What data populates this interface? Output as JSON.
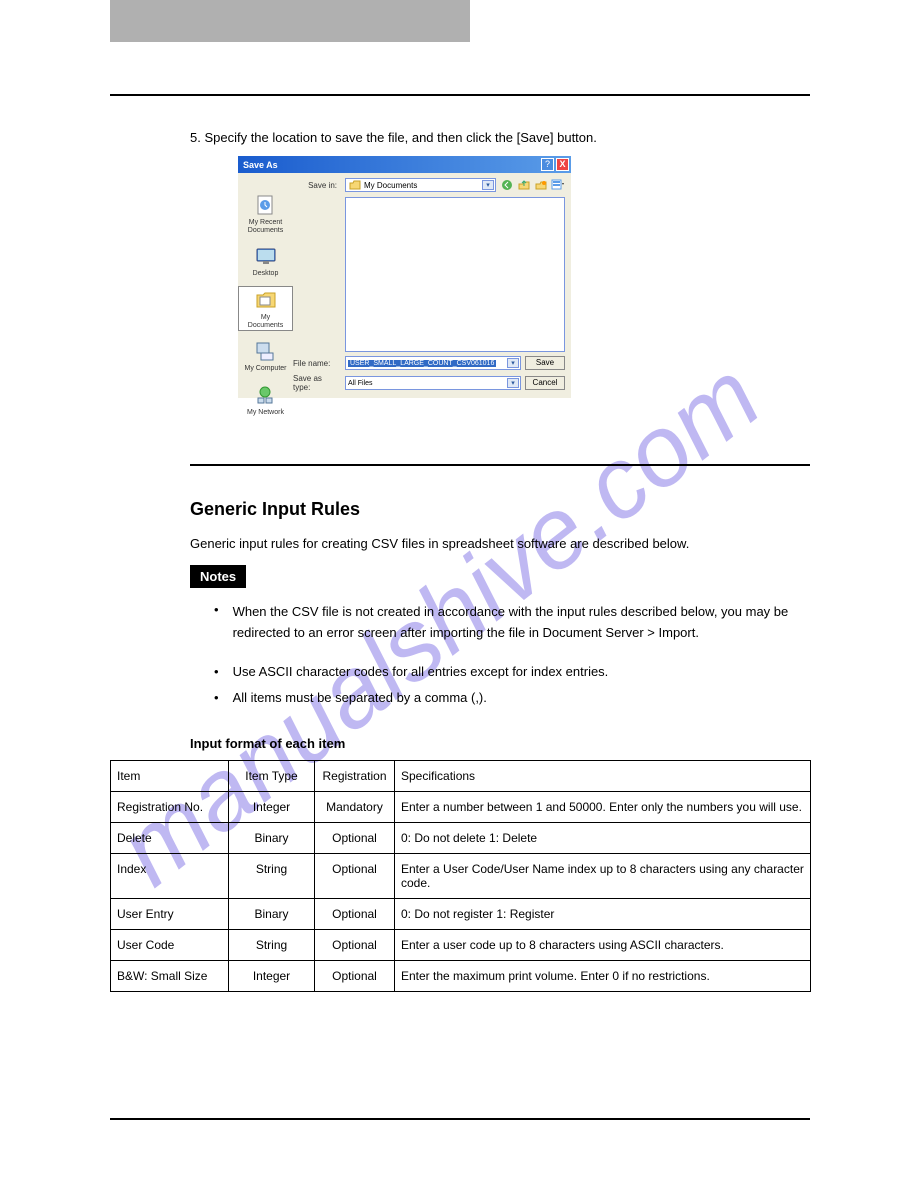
{
  "step5": "5. Specify the location to save the file, and then click the [Save] button.",
  "dialog": {
    "title": "Save As",
    "help": "?",
    "close": "X",
    "savein_label": "Save in:",
    "savein_value": "My Documents",
    "places": {
      "recent": "My Recent\nDocuments",
      "desktop": "Desktop",
      "mydocs": "My Documents",
      "mycomputer": "My Computer",
      "mynetwork": "My Network"
    },
    "filename_label": "File name:",
    "filename_value": "USER_SMALL_LARGE_COUNT_CSV061016",
    "saveastype_label": "Save as type:",
    "saveastype_value": "All Files",
    "save_btn": "Save",
    "cancel_btn": "Cancel"
  },
  "section_heading": "Generic Input Rules",
  "section_intro": "Generic input rules for creating CSV files in spreadsheet software are described below.",
  "notes_label": "Notes",
  "note1": "When the CSV file is not created in accordance with the input rules described below, you may be redirected to an error screen after importing the file in Document Server > Import.",
  "note2": "Use ASCII character codes for all entries except for index entries.",
  "note3": "All items must be separated by a comma (,).",
  "format_heading": "Input format of each item",
  "table": {
    "h_item": "Item",
    "h_type": "Item Type",
    "h_reg": "Registration",
    "h_desc": "Specifications",
    "rows": [
      {
        "item": "Registration No.",
        "type": "Integer",
        "reg": "Mandatory",
        "desc": "Enter a number between 1 and 50000. Enter only the numbers you will use."
      },
      {
        "item": "Delete",
        "type": "Binary",
        "reg": "Optional",
        "desc": "0: Do not delete 1: Delete"
      },
      {
        "item": "Index",
        "type": "String",
        "reg": "Optional",
        "desc": "Enter a User Code/User Name index up to 8 characters using any character code."
      },
      {
        "item": "User Entry",
        "type": "Binary",
        "reg": "Optional",
        "desc": "0: Do not register 1: Register"
      },
      {
        "item": "User Code",
        "type": "String",
        "reg": "Optional",
        "desc": "Enter a user code up to 8 characters using ASCII characters."
      },
      {
        "item": "B&W: Small Size",
        "type": "Integer",
        "reg": "Optional",
        "desc": "Enter the maximum print volume. Enter 0 if no restrictions."
      }
    ]
  }
}
